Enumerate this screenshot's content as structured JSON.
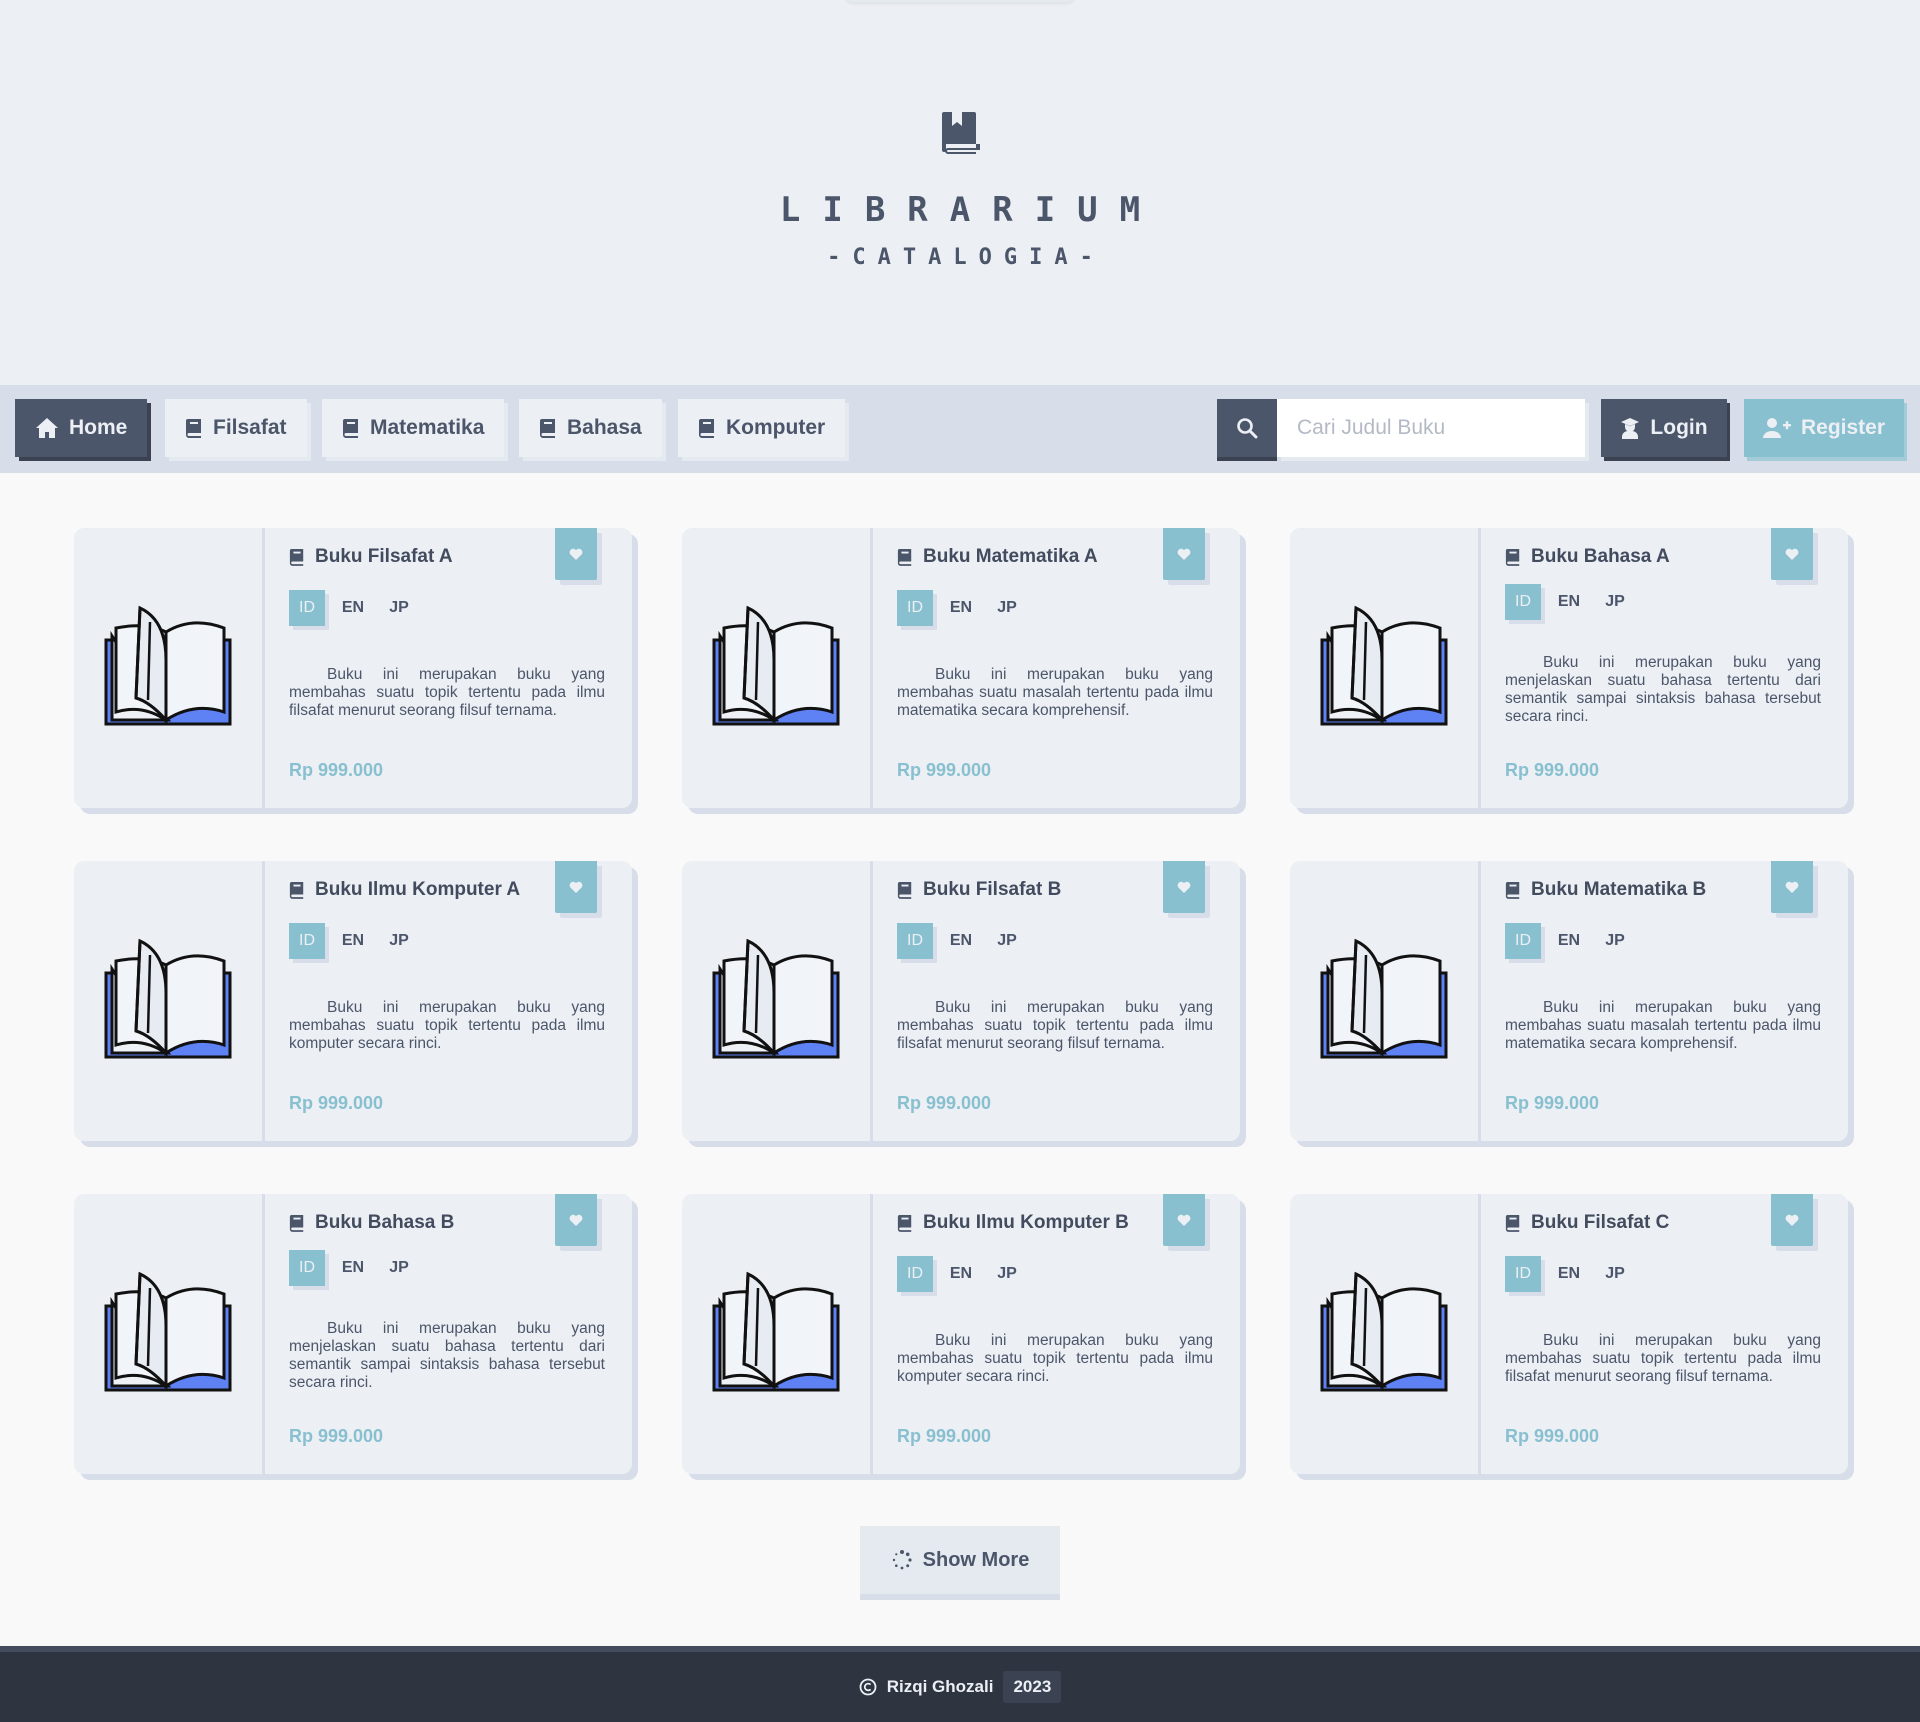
{
  "header": {
    "title": "LIBRARIUM",
    "subtitle": "-CATALOGIA-"
  },
  "nav": {
    "items": [
      {
        "label": "Home",
        "icon": "home-icon",
        "active": true
      },
      {
        "label": "Filsafat",
        "icon": "book-icon",
        "active": false
      },
      {
        "label": "Matematika",
        "icon": "book-icon",
        "active": false
      },
      {
        "label": "Bahasa",
        "icon": "book-icon",
        "active": false
      },
      {
        "label": "Komputer",
        "icon": "book-icon",
        "active": false
      }
    ],
    "search_placeholder": "Cari Judul Buku",
    "login_label": "Login",
    "register_label": "Register"
  },
  "books": [
    {
      "title": "Buku Filsafat A",
      "langs": [
        "ID",
        "EN",
        "JP"
      ],
      "selected_lang": "ID",
      "desc": "Buku ini merupakan buku yang membahas suatu topik tertentu pada ilmu filsafat menurut seorang filsuf ternama.",
      "price": "Rp 999.000"
    },
    {
      "title": "Buku Matematika A",
      "langs": [
        "ID",
        "EN",
        "JP"
      ],
      "selected_lang": "ID",
      "desc": "Buku ini merupakan buku yang membahas suatu masalah tertentu pada ilmu matematika secara komprehensif.",
      "price": "Rp 999.000"
    },
    {
      "title": "Buku Bahasa A",
      "langs": [
        "ID",
        "EN",
        "JP"
      ],
      "selected_lang": "ID",
      "desc": "Buku ini merupakan buku yang menjelaskan suatu bahasa tertentu dari semantik sampai sintaksis bahasa tersebut secara rinci.",
      "price": "Rp 999.000"
    },
    {
      "title": "Buku Ilmu Komputer A",
      "langs": [
        "ID",
        "EN",
        "JP"
      ],
      "selected_lang": "ID",
      "desc": "Buku ini merupakan buku yang membahas suatu topik tertentu pada ilmu komputer secara rinci.",
      "price": "Rp 999.000"
    },
    {
      "title": "Buku Filsafat B",
      "langs": [
        "ID",
        "EN",
        "JP"
      ],
      "selected_lang": "ID",
      "desc": "Buku ini merupakan buku yang membahas suatu topik tertentu pada ilmu filsafat menurut seorang filsuf ternama.",
      "price": "Rp 999.000"
    },
    {
      "title": "Buku Matematika B",
      "langs": [
        "ID",
        "EN",
        "JP"
      ],
      "selected_lang": "ID",
      "desc": "Buku ini merupakan buku yang membahas suatu masalah tertentu pada ilmu matematika secara komprehensif.",
      "price": "Rp 999.000"
    },
    {
      "title": "Buku Bahasa B",
      "langs": [
        "ID",
        "EN",
        "JP"
      ],
      "selected_lang": "ID",
      "desc": "Buku ini merupakan buku yang menjelaskan suatu bahasa tertentu dari semantik sampai sintaksis bahasa tersebut secara rinci.",
      "price": "Rp 999.000"
    },
    {
      "title": "Buku Ilmu Komputer B",
      "langs": [
        "ID",
        "EN",
        "JP"
      ],
      "selected_lang": "ID",
      "desc": "Buku ini merupakan buku yang membahas suatu topik tertentu pada ilmu komputer secara rinci.",
      "price": "Rp 999.000"
    },
    {
      "title": "Buku Filsafat C",
      "langs": [
        "ID",
        "EN",
        "JP"
      ],
      "selected_lang": "ID",
      "desc": "Buku ini merupakan buku yang membahas suatu topik tertentu pada ilmu filsafat menurut seorang filsuf ternama.",
      "price": "Rp 999.000"
    }
  ],
  "show_more_label": "Show More",
  "footer": {
    "author": "Rizqi Ghozali",
    "year": "2023"
  },
  "colors": {
    "accent": "#88c0d0",
    "dark": "#4c566a",
    "background": "#eceff4",
    "footer": "#2e3440"
  }
}
